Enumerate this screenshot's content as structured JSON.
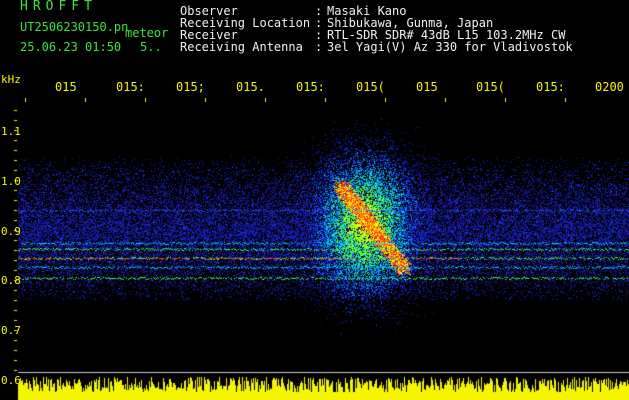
{
  "header": {
    "app_title": "HROFFT",
    "filename": "UT2506230150.pn",
    "mode_label": "meteor",
    "datetime": "25.06.23 01:50",
    "count": "5.."
  },
  "info": [
    {
      "key": "Observer",
      "value": "Masaki Kano"
    },
    {
      "key": "Receiving Location",
      "value": "Shibukawa, Gunma, Japan"
    },
    {
      "key": "Receiver",
      "value": "RTL-SDR SDR# 43dB L15 103.2MHz CW"
    },
    {
      "key": "Receiving Antenna",
      "value": "3el Yagi(V) Az 330 for Vladivostok"
    }
  ],
  "axis": {
    "unit": "kHz",
    "time_ticks": [
      "015",
      "015:",
      "015;",
      "015.",
      "015:",
      "015(",
      "015",
      "015(",
      "015:",
      "0200"
    ],
    "freq_ticks": [
      "1.1",
      "1.0",
      "0.9",
      "0.8",
      "0.7",
      "0.6"
    ]
  },
  "colors": {
    "background": "#000000",
    "title": "#3fe13f",
    "axis": "#f5f500",
    "text": "#f0f0f0"
  }
}
